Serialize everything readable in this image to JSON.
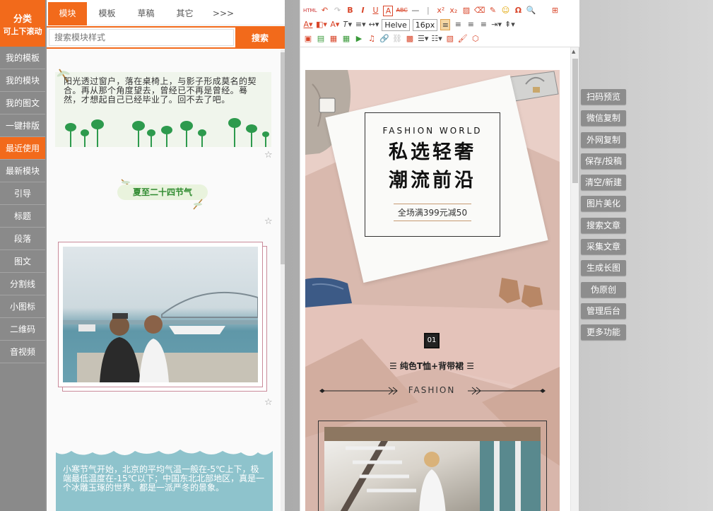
{
  "category": {
    "title_line1": "分类",
    "title_line2": "可上下滚动",
    "items": [
      {
        "label": "我的模板"
      },
      {
        "label": "我的模块"
      },
      {
        "label": "我的图文"
      },
      {
        "label": "一键排版"
      },
      {
        "label": "最近使用",
        "active": true
      },
      {
        "label": "最新模块"
      },
      {
        "label": "引导"
      },
      {
        "label": "标题"
      },
      {
        "label": "段落"
      },
      {
        "label": "图文"
      },
      {
        "label": "分割线"
      },
      {
        "label": "小图标"
      },
      {
        "label": "二维码"
      },
      {
        "label": "音视频"
      }
    ]
  },
  "tabs": [
    {
      "label": "模块",
      "active": true
    },
    {
      "label": "模板"
    },
    {
      "label": "草稿"
    },
    {
      "label": "其它"
    },
    {
      "label": ">>>"
    }
  ],
  "search": {
    "placeholder": "搜索模块样式",
    "button": "搜索"
  },
  "cards": {
    "card1_text": "阳光透过窗户，落在桌椅上，与影子形成莫名的契合。再从那个角度望去，曾经已不再是曾经。蓦然，才想起自己已经毕业了。回不去了吧。",
    "card2_text": "夏至二十四节气",
    "card4_text": "小寒节气开始，北京的平均气温一般在-5℃上下，极端最低温度在-15℃以下；中国东北北部地区，真是一个冰雕玉琢的世界。都是一派严冬的景象。"
  },
  "toolbar": {
    "html_label": "HTML",
    "font_name": "Helve",
    "font_size": "16px",
    "bold": "B",
    "italic": "I",
    "underline": "U",
    "font_color": "A",
    "abc": "ABC",
    "omega": "Ω",
    "x2": "x²",
    "x_2": "x₂"
  },
  "poster": {
    "en_title": "FASHION WORLD",
    "zh_line1": "私选轻奢",
    "zh_line2": "潮流前沿",
    "promo": "全场满399元减50",
    "num": "01",
    "subtitle": "纯色T恤+背带裙",
    "fashion": "FASHION"
  },
  "actions": [
    "扫码预览",
    "微信复制",
    "外网复制",
    "保存/投稿",
    "清空/新建",
    "图片美化",
    "搜索文章",
    "采集文章",
    "生成长图",
    "伪原创",
    "管理后台",
    "更多功能"
  ],
  "colors": {
    "accent": "#f26a1b",
    "sidebar": "#8a8a8a",
    "action_button": "#8d8d8d",
    "poster_bg": "#e6c8c0"
  }
}
